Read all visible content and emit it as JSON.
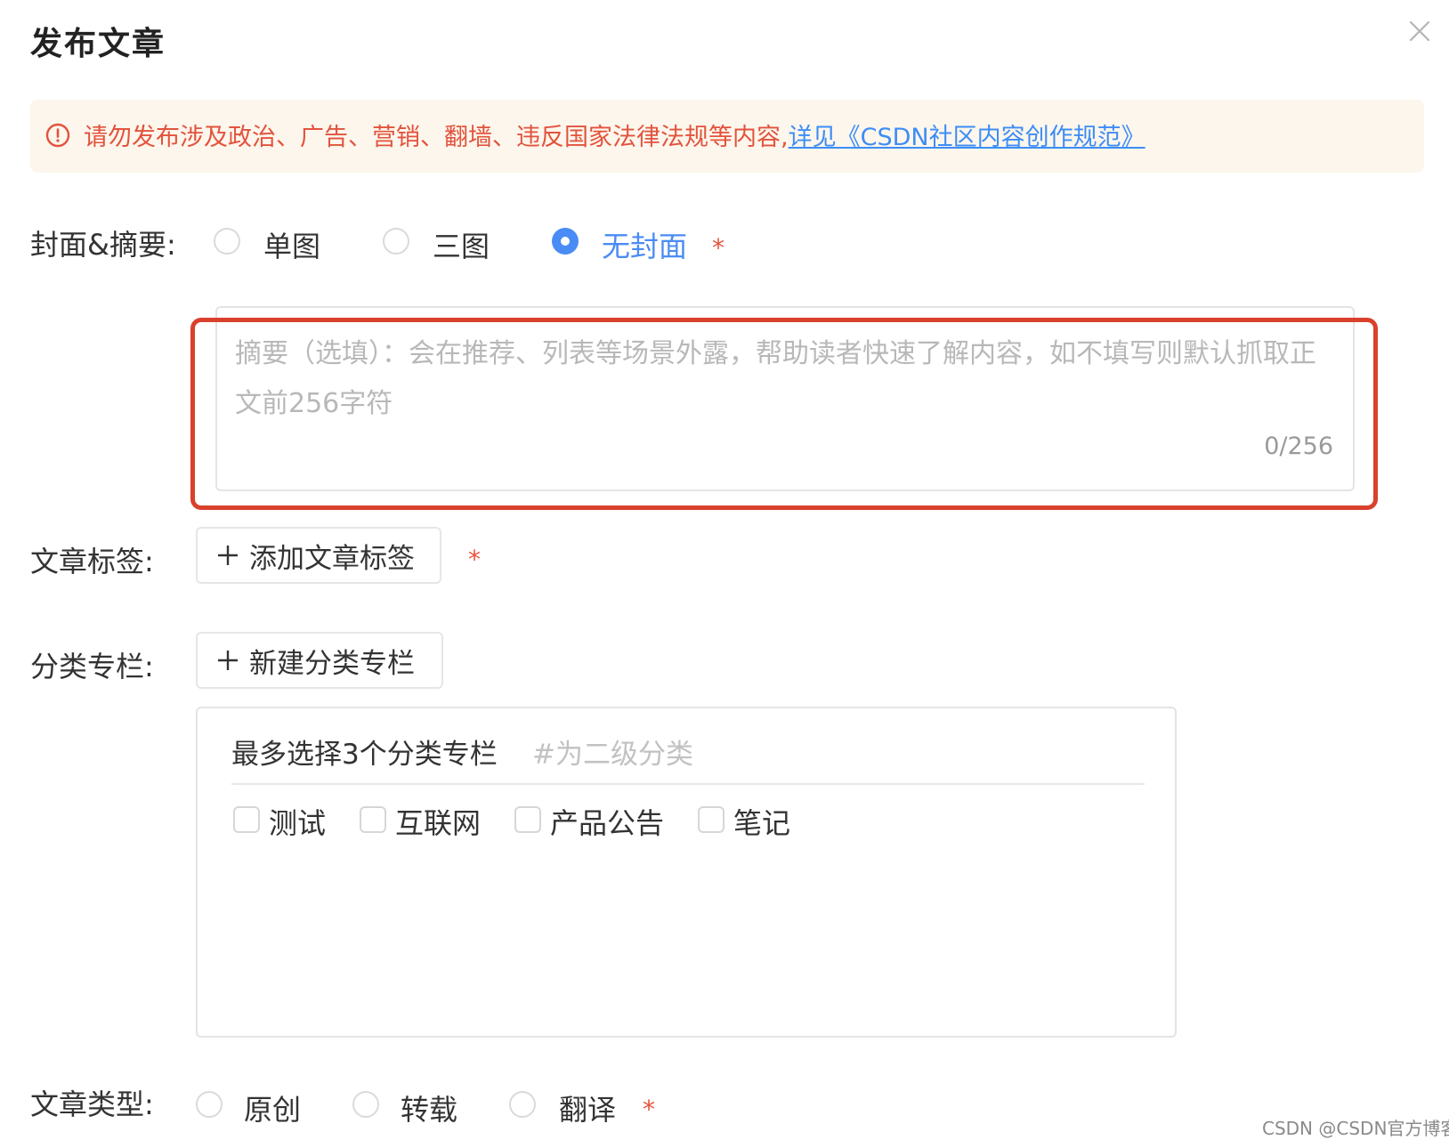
{
  "dialog": {
    "title": "发布文章",
    "close_icon": "close-icon"
  },
  "notice": {
    "icon": "warning-circle-icon",
    "text": "请勿发布涉及政治、广告、营销、翻墙、违反国家法律法规等内容,",
    "link": "详见《CSDN社区内容创作规范》",
    "color": "#e2533d",
    "link_color": "#3d8df6",
    "background": "#fdf6ec"
  },
  "cover": {
    "label": "封面&摘要:",
    "options": [
      {
        "label": "单图",
        "selected": false
      },
      {
        "label": "三图",
        "selected": false
      },
      {
        "label": "无封面",
        "selected": true
      }
    ],
    "required_mark": "*"
  },
  "summary": {
    "placeholder": "摘要（选填）：会在推荐、列表等场景外露，帮助读者快速了解内容，如不填写则默认抓取正文前256字符",
    "counter": "0/256",
    "highlight_color": "#d9412d"
  },
  "tags": {
    "label": "文章标签:",
    "add_button": "添加文章标签",
    "required_mark": "*"
  },
  "category": {
    "label": "分类专栏:",
    "new_button": "新建分类专栏",
    "box_title": "最多选择3个分类专栏",
    "box_hint": "#为二级分类",
    "items": [
      {
        "label": "测试",
        "checked": false
      },
      {
        "label": "互联网",
        "checked": false
      },
      {
        "label": "产品公告",
        "checked": false
      },
      {
        "label": "笔记",
        "checked": false
      }
    ]
  },
  "article_type": {
    "label": "文章类型:",
    "options": [
      {
        "label": "原创",
        "selected": false
      },
      {
        "label": "转载",
        "selected": false
      },
      {
        "label": "翻译",
        "selected": false
      }
    ],
    "required_mark": "*"
  },
  "watermark": "CSDN @CSDN官方博客",
  "colors": {
    "accent": "#4a8cf6",
    "required": "#e8543d"
  }
}
